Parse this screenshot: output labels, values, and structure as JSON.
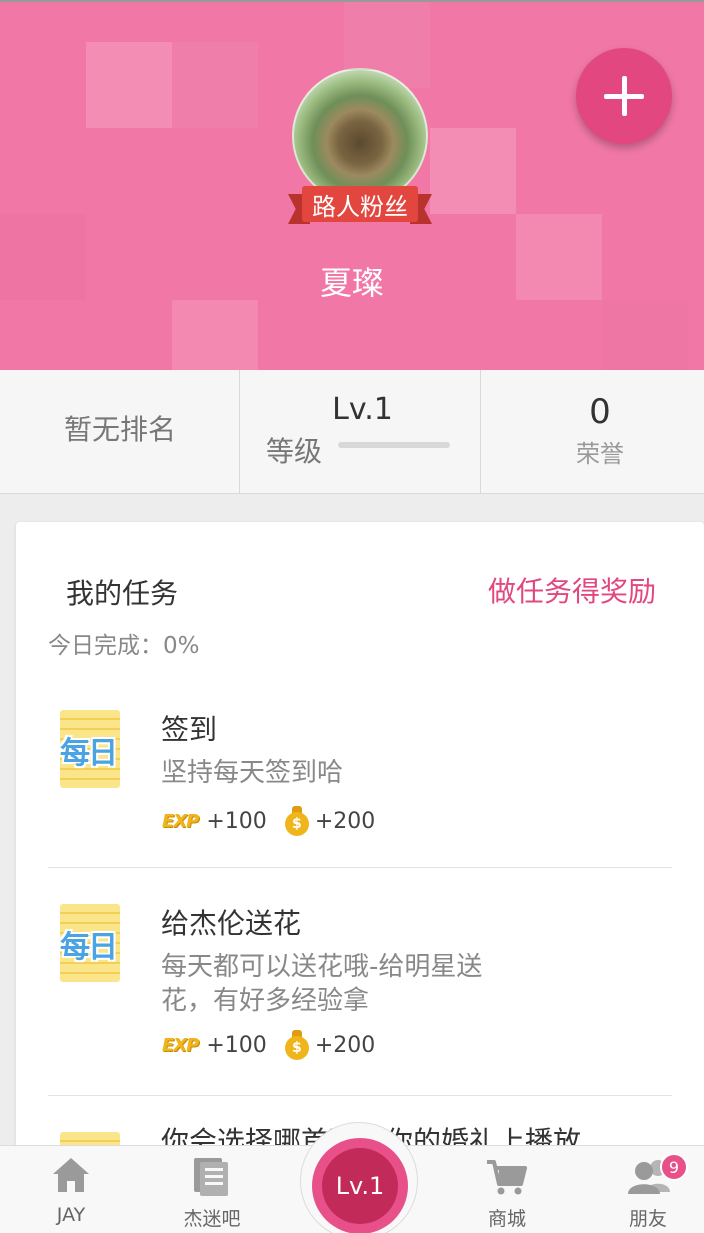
{
  "profile": {
    "badge_label": "路人粉丝",
    "username": "夏璨"
  },
  "stats": {
    "rank_text": "暂无排名",
    "level_value": "Lv.1",
    "level_label": "等级",
    "level_progress": 0,
    "honor_value": "0",
    "honor_label": "荣誉"
  },
  "tasks_card": {
    "title": "我的任务",
    "reward_link": "做任务得奖励",
    "progress_text": "今日完成：0%",
    "daily_icon_text": "每日",
    "exp_icon_text": "EXP",
    "coin_icon_text": "$",
    "tasks": [
      {
        "name": "签到",
        "desc": "坚持每天签到哈",
        "exp": "+100",
        "coins": "+200"
      },
      {
        "name": "给杰伦送花",
        "desc": "每天都可以送花哦-给明星送花，有好多经验拿",
        "exp": "+100",
        "coins": "+200"
      },
      {
        "name": "你会选择哪首歌在你的婚礼上播放"
      }
    ]
  },
  "bottom_nav": {
    "items": [
      {
        "label": "JAY",
        "icon": "home-icon"
      },
      {
        "label": "杰迷吧",
        "icon": "forum-icon"
      },
      {
        "label": "商城",
        "icon": "cart-icon"
      },
      {
        "label": "朋友",
        "icon": "friends-icon"
      }
    ],
    "center_label": "Lv.1",
    "friends_badge": "9"
  },
  "colors": {
    "header_pink": "#f178a6",
    "accent": "#e2477f",
    "ribbon_red": "#e2463f"
  }
}
